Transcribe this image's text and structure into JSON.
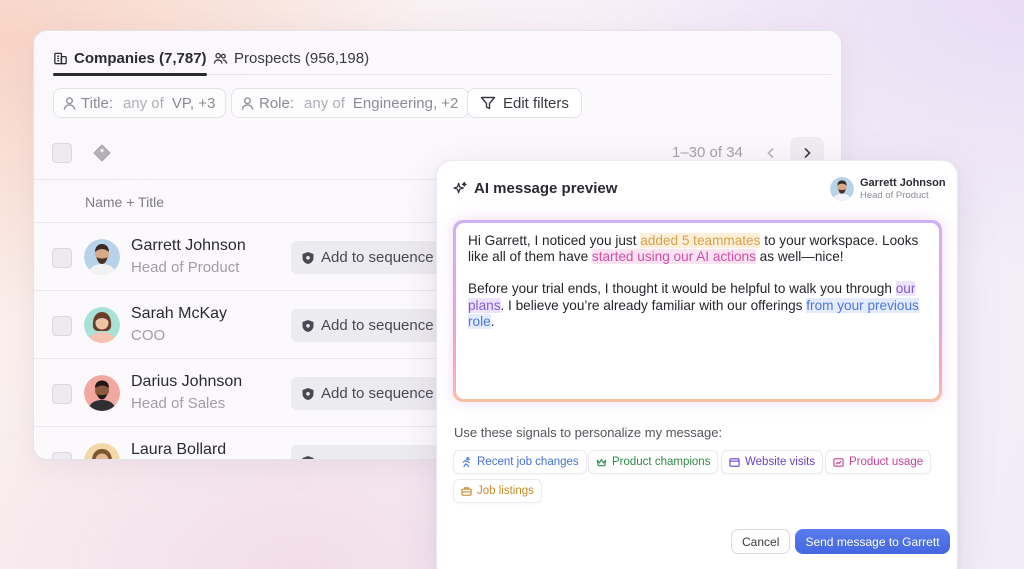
{
  "tabs": {
    "companies": "Companies (7,787)",
    "prospects": "Prospects (956,198)"
  },
  "filters": {
    "title": {
      "key": "Title:",
      "op": "any of",
      "value": "VP, +3"
    },
    "role": {
      "key": "Role:",
      "op": "any of",
      "value": "Engineering, +2"
    },
    "edit_label": "Edit filters"
  },
  "pagination": {
    "range": "1–30 of 34"
  },
  "table": {
    "column_header": "Name + Title",
    "rows": [
      {
        "name": "Garrett Johnson",
        "title": "Head of Product",
        "action": "Add to sequence"
      },
      {
        "name": "Sarah McKay",
        "title": "COO",
        "action": "Add to sequence"
      },
      {
        "name": "Darius Johnson",
        "title": "Head of Sales",
        "action": "Add to sequence"
      },
      {
        "name": "Laura Bollard",
        "title": "",
        "action": ""
      }
    ]
  },
  "ai_preview": {
    "heading": "AI message preview",
    "recipient": {
      "name": "Garrett Johnson",
      "title": "Head of Product"
    },
    "message": {
      "p1_a": "Hi Garrett, I noticed you just ",
      "p1_hl1": "added 5 teammates",
      "p1_b": " to your workspace. Looks like all of them have ",
      "p1_hl2": "started using our AI actions",
      "p1_c": " as well—nice!",
      "p2_a": "Before your trial ends, I thought it would be helpful to walk you through ",
      "p2_hl1": "our plans",
      "p2_b": ". I believe you’re already familiar with our offerings ",
      "p2_hl2": "from your previous role",
      "p2_c": "."
    },
    "signals_label": "Use these signals to personalize my message:",
    "signals": [
      "Recent job changes",
      "Product champions",
      "Website visits",
      "Product usage",
      "Job listings"
    ],
    "cancel_label": "Cancel",
    "send_label": "Send message to Garrett"
  },
  "colors": {
    "send_button": "#4a6be3",
    "highlight_orange": "#d9a049",
    "highlight_pink": "#d44ea9",
    "highlight_purple": "#8a5ad6",
    "highlight_blue": "#4d78db"
  }
}
